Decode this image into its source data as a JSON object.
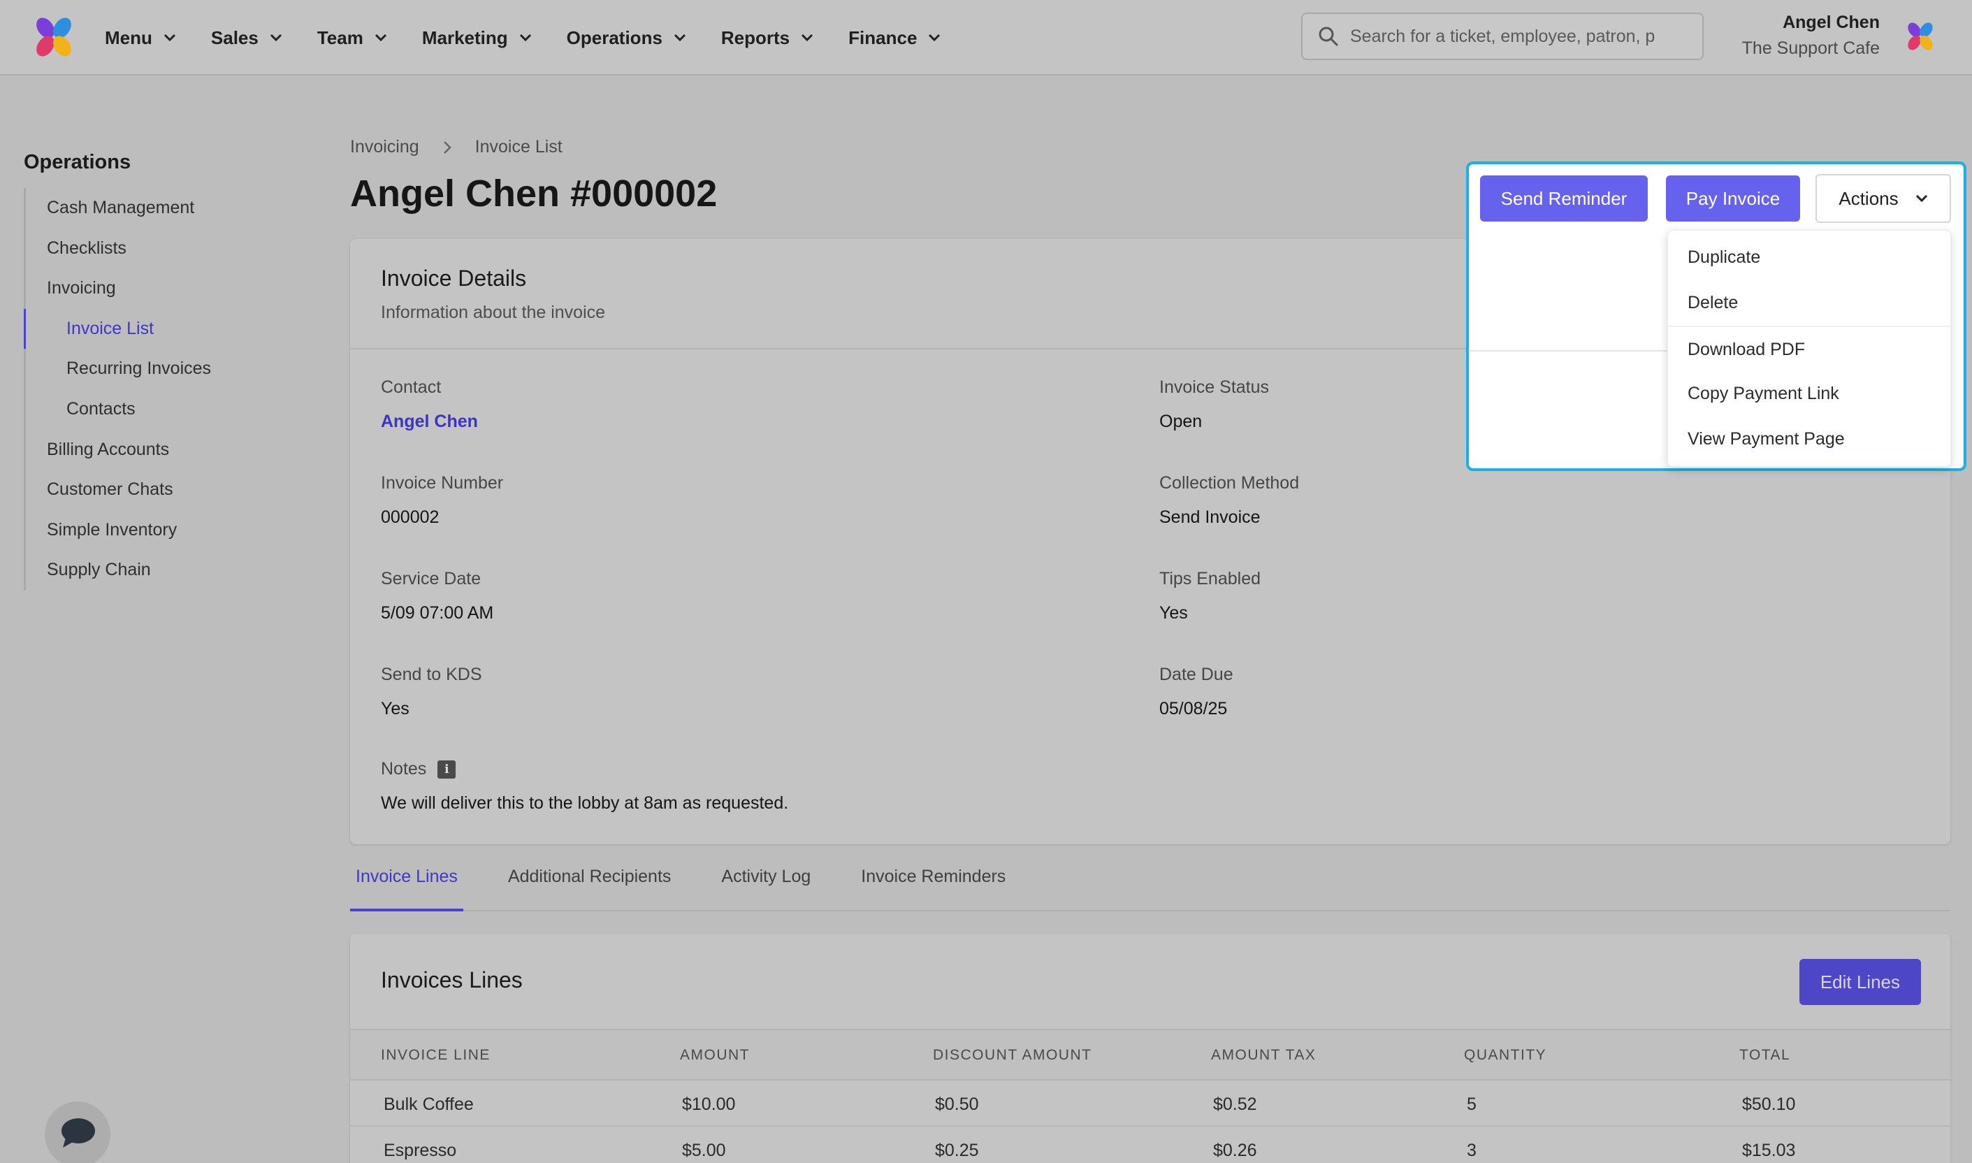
{
  "nav": {
    "items": [
      "Menu",
      "Sales",
      "Team",
      "Marketing",
      "Operations",
      "Reports",
      "Finance"
    ],
    "search_placeholder": "Search for a ticket, employee, patron, p",
    "user_name": "Angel Chen",
    "org_name": "The Support Cafe"
  },
  "sidebar": {
    "section": "Operations",
    "items": [
      "Cash Management",
      "Checklists",
      "Invoicing",
      "Invoice List",
      "Recurring Invoices",
      "Contacts",
      "Billing Accounts",
      "Customer Chats",
      "Simple Inventory",
      "Supply Chain"
    ],
    "active": "Invoice List"
  },
  "breadcrumb": [
    "Invoicing",
    "Invoice List"
  ],
  "page_title": "Angel Chen #000002",
  "actions": {
    "send_reminder": "Send Reminder",
    "pay_invoice": "Pay Invoice",
    "actions_label": "Actions",
    "menu": [
      "Duplicate",
      "Delete",
      "Download PDF",
      "Copy Payment Link",
      "View Payment Page"
    ]
  },
  "details": {
    "title": "Invoice Details",
    "subtitle": "Information about the invoice",
    "fields": {
      "contact": {
        "label": "Contact",
        "value": "Angel Chen"
      },
      "status": {
        "label": "Invoice Status",
        "value": "Open"
      },
      "number": {
        "label": "Invoice Number",
        "value": "000002"
      },
      "collection": {
        "label": "Collection Method",
        "value": "Send Invoice"
      },
      "service_date": {
        "label": "Service Date",
        "value": "5/09 07:00 AM"
      },
      "tips": {
        "label": "Tips Enabled",
        "value": "Yes"
      },
      "kds": {
        "label": "Send to KDS",
        "value": "Yes"
      },
      "date_due": {
        "label": "Date Due",
        "value": "05/08/25"
      },
      "notes": {
        "label": "Notes",
        "value": "We will deliver this to the lobby at 8am as requested."
      }
    }
  },
  "tabs": [
    "Invoice Lines",
    "Additional Recipients",
    "Activity Log",
    "Invoice Reminders"
  ],
  "lines": {
    "title": "Invoices Lines",
    "edit_label": "Edit Lines",
    "columns": [
      "INVOICE LINE",
      "AMOUNT",
      "DISCOUNT AMOUNT",
      "AMOUNT TAX",
      "QUANTITY",
      "TOTAL"
    ],
    "rows": [
      [
        "Bulk Coffee",
        "$10.00",
        "$0.50",
        "$0.52",
        "5",
        "$50.10"
      ],
      [
        "Espresso",
        "$5.00",
        "$0.25",
        "$0.26",
        "3",
        "$15.03"
      ]
    ]
  },
  "colors": {
    "accent": "#6762ee",
    "highlight": "#1ab0e8",
    "link": "#3b34c4"
  },
  "icons": [
    "app-logo-icon",
    "chevron-down-icon",
    "search-icon",
    "chevron-right-icon",
    "info-icon",
    "chat-icon"
  ]
}
